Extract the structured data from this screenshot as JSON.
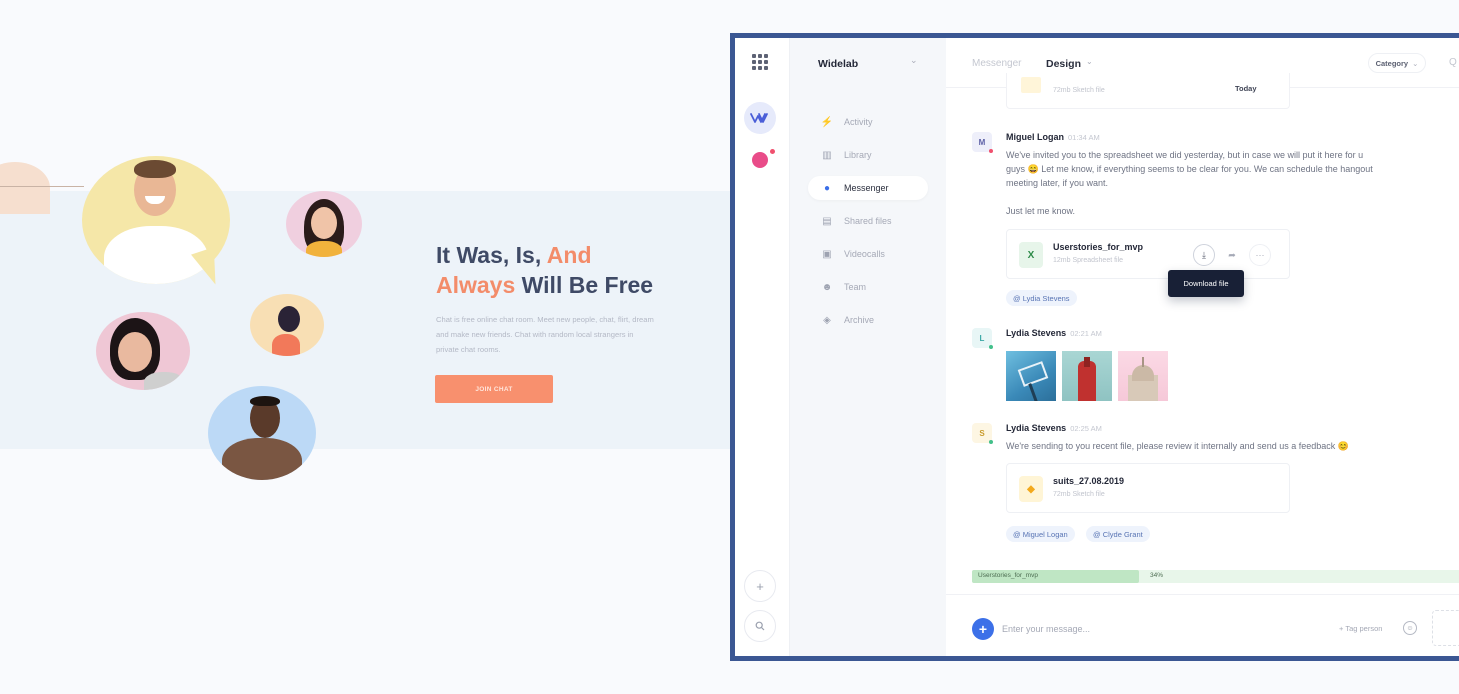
{
  "landing": {
    "headline_part1": "It Was, Is, ",
    "headline_accent1": "And",
    "headline_accent2": "Always",
    "headline_part2": " Will Be Free",
    "description": "Chat is free online chat room. Meet new people, chat, flirt, dream and make new friends. Chat with random local strangers in private chat rooms.",
    "cta_label": "JOIN CHAT"
  },
  "app": {
    "workspace_name": "Widelab",
    "nav": [
      {
        "label": "Activity",
        "icon": "bolt-icon"
      },
      {
        "label": "Library",
        "icon": "library-icon"
      },
      {
        "label": "Messenger",
        "icon": "chat-icon",
        "active": true
      },
      {
        "label": "Shared files",
        "icon": "folder-icon"
      },
      {
        "label": "Videocalls",
        "icon": "video-icon"
      },
      {
        "label": "Team",
        "icon": "team-icon"
      },
      {
        "label": "Archive",
        "icon": "layers-icon"
      }
    ],
    "breadcrumb": {
      "parent": "Messenger",
      "current": "Design"
    },
    "category_label": "Category",
    "search_fragment": "Q",
    "prev_file_size": "72mb Sketch file",
    "today_label": "Today",
    "messages": [
      {
        "author": "Miguel Logan",
        "initial": "M",
        "time": "01:34 AM",
        "line1": "We've invited you to the spreadsheet we did yesterday, but in case we will put it here for u",
        "line2": "guys 😄 Let me know, if everything seems to be clear for you. We can schedule the hangout",
        "line3": "meeting later, if you want.",
        "line4": "Just let me know.",
        "file": {
          "name": "Userstories_for_mvp",
          "meta": "12mb Spreadsheet file"
        },
        "tooltip": "Download file",
        "tags": [
          "@ Lydia Stevens"
        ]
      },
      {
        "author": "Lydia Stevens",
        "initial": "L",
        "time": "02:21 AM"
      },
      {
        "author": "Lydia Stevens",
        "initial": "S",
        "time": "02:25 AM",
        "text": "We're sending to you recent file, please review it internally and send us a feedback 😊",
        "file": {
          "name": "suits_27.08.2019",
          "meta": "72mb Sketch file"
        },
        "tags": [
          "@ Miguel Logan",
          "@ Clyde Grant"
        ]
      }
    ],
    "upload": {
      "name": "Userstories_for_mvp",
      "percent_label": "34%",
      "percent": 34
    },
    "composer": {
      "placeholder": "Enter your message...",
      "tag_person": "+ Tag person"
    },
    "colors": {
      "accent": "#3c70e8",
      "brand_frame": "#3b5793",
      "cta": "#f8906e",
      "headline_accent": "#f38c6a"
    }
  }
}
